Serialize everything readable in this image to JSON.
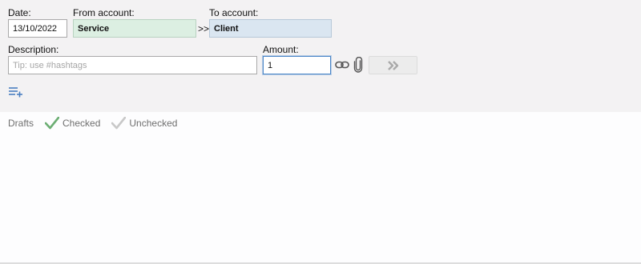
{
  "form": {
    "date_label": "Date:",
    "date_value": "13/10/2022",
    "from_label": "From account:",
    "from_value": "Service",
    "arrow": ">>",
    "to_label": "To account:",
    "to_value": "Client",
    "description_label": "Description:",
    "description_placeholder": "Tip: use #hashtags",
    "description_value": "",
    "amount_label": "Amount:",
    "amount_value": "1"
  },
  "icons": {
    "link": "link-icon",
    "attach": "paperclip-icon",
    "submit": "double-chevron-right-icon",
    "add_rows": "add-list-icon",
    "checked": "checkmark-icon",
    "unchecked": "checkmark-icon"
  },
  "colors": {
    "from_bg": "#dcefe2",
    "to_bg": "#dae6f1",
    "checked": "#6cae73",
    "unchecked": "#c8c8c8",
    "add_icon": "#4a7fc1"
  },
  "filters": {
    "drafts": "Drafts",
    "checked": "Checked",
    "unchecked": "Unchecked"
  }
}
